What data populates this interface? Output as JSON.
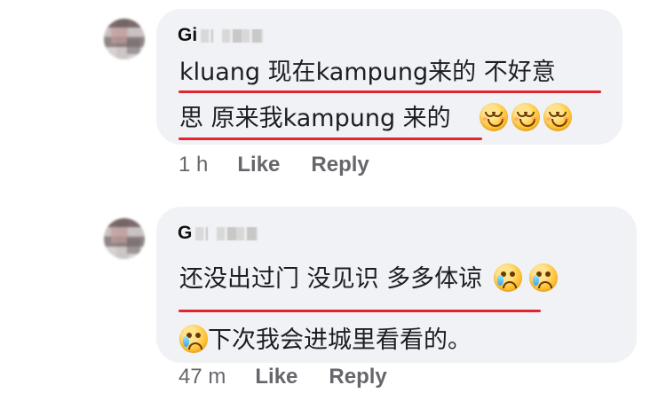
{
  "comments": [
    {
      "author": {
        "visible_initials": "Gi",
        "avatar_icon": "profile-avatar-icon"
      },
      "text_lines": [
        "kluang 现在kampung来的 不好意",
        "思 原来我kampung 来的"
      ],
      "emoji": [
        "smiling-face-with-smiling-eyes",
        "smiling-face-with-smiling-eyes",
        "smiling-face-with-smiling-eyes"
      ],
      "time": "1 h",
      "actions": {
        "like": "Like",
        "reply": "Reply"
      }
    },
    {
      "author": {
        "visible_initials": "G",
        "avatar_icon": "profile-avatar-icon"
      },
      "text_lines": [
        "还没出过门 没见识 多多体谅",
        "下次我会进城里看看的。"
      ],
      "emoji": [
        "crying-face",
        "crying-face",
        "crying-face"
      ],
      "time": "47 m",
      "actions": {
        "like": "Like",
        "reply": "Reply"
      }
    }
  ],
  "colors": {
    "bubble": "#f0f2f5",
    "text": "#1c1e21",
    "meta": "#65676b",
    "underline": "#e22531",
    "emoji_face": "#ffc53d"
  }
}
